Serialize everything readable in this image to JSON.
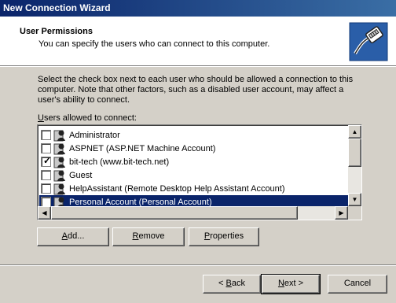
{
  "window": {
    "title": "New Connection Wizard"
  },
  "header": {
    "title": "User Permissions",
    "subtitle": "You can specify the users who can connect to this computer."
  },
  "instructions": "Select the check box next to each user who should be allowed a connection to this computer.  Note that other factors, such as a disabled user account, may affect a user's ability to connect.",
  "list": {
    "label_pre": "",
    "label_key": "U",
    "label_post": "sers allowed to connect:",
    "items": [
      {
        "label": "Administrator",
        "checked": false,
        "selected": false
      },
      {
        "label": "ASPNET (ASP.NET Machine Account)",
        "checked": false,
        "selected": false
      },
      {
        "label": "bit-tech (www.bit-tech.net)",
        "checked": true,
        "selected": false
      },
      {
        "label": "Guest",
        "checked": false,
        "selected": false
      },
      {
        "label": "HelpAssistant (Remote Desktop Help Assistant Account)",
        "checked": false,
        "selected": false
      },
      {
        "label": "Personal Account (Personal Account)",
        "checked": false,
        "selected": true
      }
    ]
  },
  "buttons": {
    "add": {
      "key": "A",
      "rest": "dd..."
    },
    "remove": {
      "key": "R",
      "rest": "emove"
    },
    "properties": {
      "key": "P",
      "rest": "roperties"
    },
    "back": {
      "pre": "< ",
      "key": "B",
      "rest": "ack"
    },
    "next": {
      "key": "N",
      "rest": "ext >"
    },
    "cancel": {
      "label": "Cancel"
    }
  },
  "colors": {
    "title_bar": "#0a246a",
    "selection": "#0a246a",
    "face": "#d4d0c8"
  },
  "icons": {
    "header": "network-cable-icon",
    "user": "user-icon",
    "check": "checkmark"
  }
}
